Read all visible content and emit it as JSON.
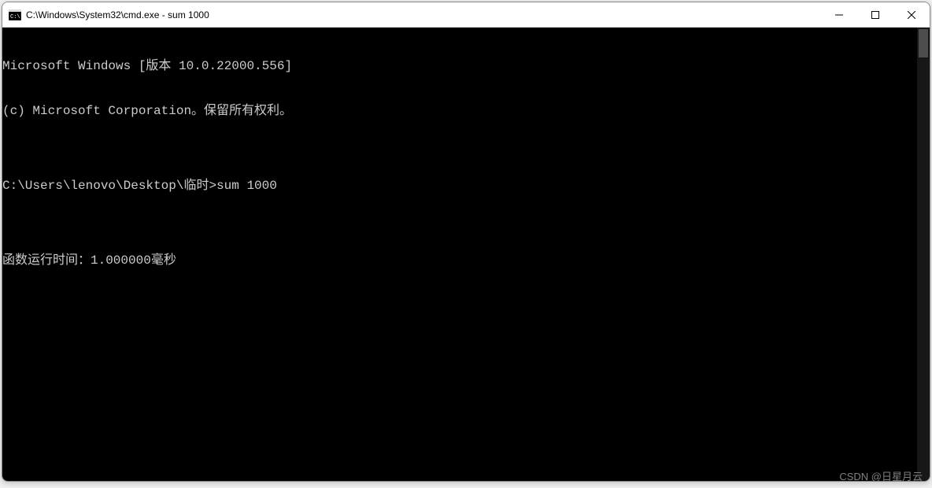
{
  "window": {
    "title": "C:\\Windows\\System32\\cmd.exe - sum  1000"
  },
  "terminal": {
    "lines": [
      "Microsoft Windows [版本 10.0.22000.556]",
      "(c) Microsoft Corporation。保留所有权利。",
      "",
      "C:\\Users\\lenovo\\Desktop\\临时>sum 1000",
      "",
      "函数运行时间：1.000000毫秒"
    ]
  },
  "watermark": "CSDN @日星月云"
}
